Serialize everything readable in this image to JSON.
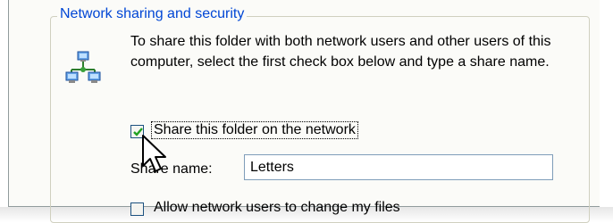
{
  "group": {
    "title": "Network sharing and security",
    "description": "To share this folder with both network users and other users of this computer, select the first check box below and type a share name."
  },
  "share_checkbox": {
    "label": "Share this folder on the network",
    "checked": true
  },
  "share_name": {
    "label": "Share name:",
    "value": "Letters"
  },
  "allow_checkbox": {
    "label": "Allow network users to change my files",
    "checked": false
  },
  "icons": {
    "network": "network-computers-icon",
    "cursor": "mouse-pointer-icon"
  },
  "colors": {
    "group_title": "#0046d5",
    "check_green": "#21a121",
    "input_border": "#7f9db9"
  }
}
